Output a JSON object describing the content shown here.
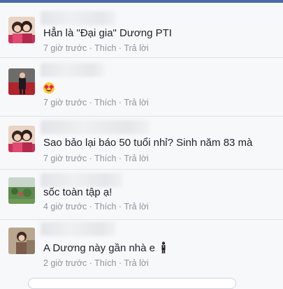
{
  "comments": [
    {
      "text": "Hẳn là \"Đại gia\"  Dương PTI",
      "time": "7 giờ trước",
      "like": "Thích",
      "reply": "Trả lời",
      "avatar": "couple-photo"
    },
    {
      "text": "",
      "emoji": "heart-eyes-emoji",
      "time": "7 giờ trước",
      "like": "Thích",
      "reply": "Trả lời",
      "avatar": "man-on-red-carpet-photo"
    },
    {
      "text": "Sao  bảo lại báo 50 tuổi nhỉ? Sinh năm 83 mà",
      "time": "7 giờ trước",
      "like": "Thích",
      "reply": "Trả lời",
      "avatar": "couple-photo"
    },
    {
      "text": "sốc toàn tập ạ!",
      "time": "4 giờ trước",
      "like": "Thích",
      "reply": "Trả lời",
      "avatar": "landscape-photo"
    },
    {
      "text": "A Dương này gần nhà e",
      "emoji": "man-in-suit-emoji",
      "time": "2 giờ trước",
      "like": "Thích",
      "reply": "Trả lời",
      "avatar": "woman-photo"
    }
  ],
  "separator": " · ",
  "colors": {
    "accent": "#4a6aa8",
    "text": "#1d2129",
    "meta": "#90949c",
    "background": "#f7f8fa"
  }
}
